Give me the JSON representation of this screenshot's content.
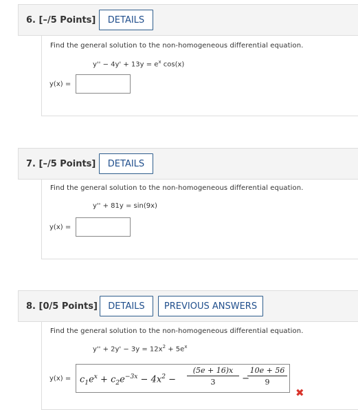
{
  "questions": [
    {
      "number": "6.",
      "points": "[–/5 Points]",
      "details_label": "DETAILS",
      "prompt": "Find the general solution to the non-homogeneous differential equation.",
      "equation": {
        "lhs": "y'' − 4y' + 13y = e",
        "exp": "x",
        "rhs": " cos(x)"
      },
      "answer_label": "y(x) =",
      "answer_value": ""
    },
    {
      "number": "7.",
      "points": "[–/5 Points]",
      "details_label": "DETAILS",
      "prompt": "Find the general solution to the non-homogeneous differential equation.",
      "equation": {
        "lhs": "y'' + 81y = sin(9x)"
      },
      "answer_label": "y(x) =",
      "answer_value": ""
    },
    {
      "number": "8.",
      "points": "[0/5 Points]",
      "details_label": "DETAILS",
      "previous_answers_label": "PREVIOUS ANSWERS",
      "prompt": "Find the general solution to the non-homogeneous differential equation.",
      "equation": {
        "lhs": "y'' + 2y' − 3y = 12x",
        "exp1": "2",
        "mid": " + 5e",
        "exp2": "x"
      },
      "answer_label": "y(x) =",
      "answer": {
        "c1": "c",
        "c1_sub": "1",
        "e1": "e",
        "e1_exp": "x",
        "plus": " + ",
        "c2": "c",
        "c2_sub": "2",
        "e2": "e",
        "e2_exp": "−3x",
        "term3": " − 4x",
        "term3_exp": "2",
        "minus1": " − ",
        "frac1_num": "(5e + 16)x",
        "frac1_den": "3",
        "minus2": " − ",
        "frac2_num": "10e + 56",
        "frac2_den": "9"
      },
      "status": "incorrect",
      "status_icon": "x-mark-icon",
      "status_color": "#d9342b"
    }
  ],
  "colors": {
    "button_text": "#1f4e8c",
    "button_border": "#2e5d8c",
    "header_bg": "#f4f4f4"
  }
}
